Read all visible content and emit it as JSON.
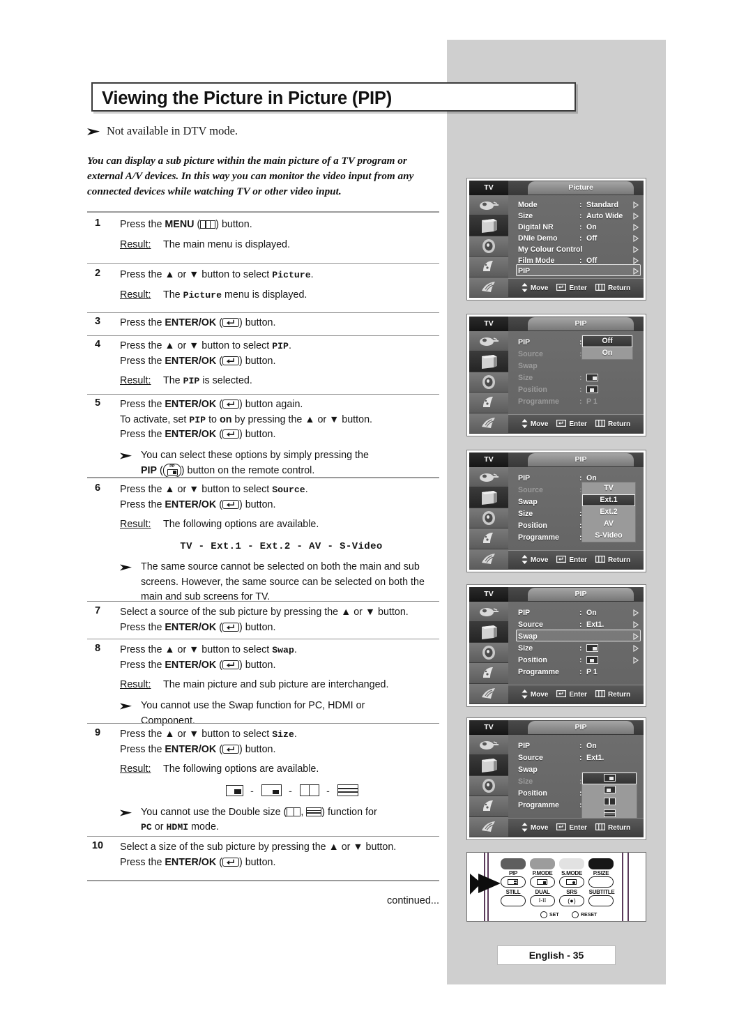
{
  "page": {
    "title": "Viewing the Picture in Picture (PIP)",
    "note": "Not available in DTV mode.",
    "intro": "You can display a sub picture within the main picture of a TV program or external A/V devices. In this way you can monitor the video input from any connected devices while watching TV or other video input.",
    "continued": "continued...",
    "footer_badge": "English - 35"
  },
  "labels": {
    "press_the": "Press the",
    "result": "Result:",
    "button_word": "button.",
    "or": "or"
  },
  "steps": [
    {
      "num": "1",
      "line1_a": "Press the ",
      "line1_b": "MENU",
      "line1_c": " (",
      "line1_d": ") button.",
      "result_label": "Result:",
      "result_text": "The main menu is displayed."
    },
    {
      "num": "2",
      "line1_a": "Press the ▲ or ▼ button to select ",
      "line1_b": "Picture",
      "line1_c": ".",
      "result_label": "Result:",
      "result_a": "The ",
      "result_b": "Picture",
      "result_c": " menu is displayed."
    },
    {
      "num": "3",
      "line1_a": "Press the ",
      "line1_b": "ENTER/OK",
      "line1_c": " (",
      "line1_d": ") button."
    },
    {
      "num": "4",
      "line1_a": "Press the ▲ or ▼ button to select ",
      "line1_b": "PIP",
      "line1_c": ".",
      "line2_a": "Press the ",
      "line2_b": "ENTER/OK",
      "line2_c": " (",
      "line2_d": ") button.",
      "result_label": "Result:",
      "result_a": "The ",
      "result_b": "PIP",
      "result_c": " is selected."
    },
    {
      "num": "5",
      "line1_a": "Press the ",
      "line1_b": "ENTER/OK",
      "line1_c": " (",
      "line1_d": ") button again.",
      "line2_a": "To activate, set ",
      "line2_b": "PIP",
      "line2_c": " to ",
      "line2_d": "on",
      "line2_e": " by pressing the ▲ or ▼ button.",
      "line3_a": "Press the ",
      "line3_b": "ENTER/OK",
      "line3_c": " (",
      "line3_d": ") button.",
      "bullet_a": "You can select these options by simply pressing the",
      "bullet_b": "PIP",
      "bullet_c": " (",
      "bullet_d": ") button on the remote control."
    },
    {
      "num": "6",
      "line1_a": "Press the ▲ or ▼ button to select ",
      "line1_b": "Source",
      "line1_c": ".",
      "line2_a": "Press the ",
      "line2_b": "ENTER/OK",
      "line2_c": " (",
      "line2_d": ") button.",
      "result_label": "Result:",
      "result_text": "The following options are available.",
      "options_line": "TV - Ext.1 - Ext.2 - AV - S-Video",
      "bullet_text": "The same source cannot be selected on both the main and sub screens. However, the same source can be selected on both the main and sub screens for TV."
    },
    {
      "num": "7",
      "line1_a": "Select a source of the sub picture by pressing the ▲ or ▼ button.",
      "line2_a": "Press the ",
      "line2_b": "ENTER/OK",
      "line2_c": " (",
      "line2_d": ") button."
    },
    {
      "num": "8",
      "line1_a": "Press the ▲ or ▼ button to select ",
      "line1_b": "Swap",
      "line1_c": ".",
      "line2_a": "Press the ",
      "line2_b": "ENTER/OK",
      "line2_c": " (",
      "line2_d": ") button.",
      "result_label": "Result:",
      "result_text": "The main picture and sub picture are interchanged.",
      "bullet_a": "You cannot use the Swap function for PC, HDMI or",
      "bullet_b": "Component."
    },
    {
      "num": "9",
      "line1_a": "Press the ▲ or ▼ button to select ",
      "line1_b": "Size",
      "line1_c": ".",
      "line2_a": "Press the ",
      "line2_b": "ENTER/OK",
      "line2_c": " (",
      "line2_d": ") button.",
      "result_label": "Result:",
      "result_text": "The following options are available.",
      "bullet_a": "You cannot use the Double size (",
      "bullet_b": ", ",
      "bullet_c": ") function for",
      "bullet_d": "PC",
      "bullet_e": " or ",
      "bullet_f": "HDMI",
      "bullet_g": " mode."
    },
    {
      "num": "10",
      "line1_a": "Select a size of the sub picture by pressing the ▲ or ▼ button.",
      "line2_a": "Press the ",
      "line2_b": "ENTER/OK",
      "line2_c": " (",
      "line2_d": ") button."
    }
  ],
  "osd_common": {
    "tv_label": "TV",
    "foot_move": "Move",
    "foot_enter": "Enter",
    "foot_return": "Return"
  },
  "osd_screens": [
    {
      "id": "picture-menu",
      "tab": "Picture",
      "rows": [
        {
          "label": "Mode",
          "colon": ":",
          "value": "Standard",
          "arrow": true
        },
        {
          "label": "Size",
          "colon": ":",
          "value": "Auto Wide",
          "arrow": true
        },
        {
          "label": "Digital NR",
          "colon": ":",
          "value": "On",
          "arrow": true
        },
        {
          "label": "DNIe Demo",
          "colon": ":",
          "value": "Off",
          "arrow": true
        },
        {
          "label": "My Colour Control",
          "colon": "",
          "value": "",
          "arrow": true
        },
        {
          "label": "Film Mode",
          "colon": ":",
          "value": "Off",
          "arrow": true
        },
        {
          "label": "PIP",
          "colon": "",
          "value": "",
          "arrow": true,
          "highlight": true
        }
      ]
    },
    {
      "id": "pip-onoff",
      "tab": "PIP",
      "rows": [
        {
          "label": "PIP",
          "colon": ":",
          "value": "",
          "arrow": false
        },
        {
          "label": "Source",
          "colon": ":",
          "value": "",
          "arrow": false,
          "dim": true
        },
        {
          "label": "Swap",
          "colon": "",
          "value": "",
          "arrow": false,
          "dim": true
        },
        {
          "label": "Size",
          "colon": ":",
          "value": "icon-br",
          "arrow": false,
          "dim": true
        },
        {
          "label": "Position",
          "colon": ":",
          "value": "icon-bl",
          "arrow": false,
          "dim": true
        },
        {
          "label": "Programme",
          "colon": ":",
          "value": "P  1",
          "arrow": false,
          "dim": true
        }
      ],
      "popup": {
        "items": [
          "Off",
          "On"
        ],
        "selected": "Off"
      }
    },
    {
      "id": "pip-source",
      "tab": "PIP",
      "rows": [
        {
          "label": "PIP",
          "colon": ":",
          "value": "On",
          "arrow": false
        },
        {
          "label": "Source",
          "colon": ":",
          "value": "",
          "arrow": false,
          "dim": true
        },
        {
          "label": "Swap",
          "colon": "",
          "value": "",
          "arrow": false
        },
        {
          "label": "Size",
          "colon": ":",
          "value": "",
          "arrow": false
        },
        {
          "label": "Position",
          "colon": ":",
          "value": "",
          "arrow": false
        },
        {
          "label": "Programme",
          "colon": ":",
          "value": "",
          "arrow": false
        }
      ],
      "popup": {
        "items": [
          "TV",
          "Ext.1",
          "Ext.2",
          "AV",
          "S-Video"
        ],
        "selected": "Ext.1"
      }
    },
    {
      "id": "pip-swap",
      "tab": "PIP",
      "rows": [
        {
          "label": "PIP",
          "colon": ":",
          "value": "On",
          "arrow": true
        },
        {
          "label": "Source",
          "colon": ":",
          "value": "Ext1.",
          "arrow": true
        },
        {
          "label": "Swap",
          "colon": "",
          "value": "",
          "arrow": true,
          "highlight": true
        },
        {
          "label": "Size",
          "colon": ":",
          "value": "icon-br",
          "arrow": true
        },
        {
          "label": "Position",
          "colon": ":",
          "value": "icon-bl",
          "arrow": true
        },
        {
          "label": "Programme",
          "colon": ":",
          "value": "P  1",
          "arrow": false
        }
      ]
    },
    {
      "id": "pip-size",
      "tab": "PIP",
      "rows": [
        {
          "label": "PIP",
          "colon": ":",
          "value": "On",
          "arrow": false
        },
        {
          "label": "Source",
          "colon": ":",
          "value": "Ext1.",
          "arrow": false
        },
        {
          "label": "Swap",
          "colon": "",
          "value": "",
          "arrow": false
        },
        {
          "label": "Size",
          "colon": ":",
          "value": "",
          "arrow": false,
          "dim": true
        },
        {
          "label": "Position",
          "colon": ":",
          "value": "",
          "arrow": false
        },
        {
          "label": "Programme",
          "colon": ":",
          "value": "",
          "arrow": false
        }
      ],
      "popup": {
        "items": [
          "icon-br",
          "icon-bl",
          "icon-v",
          "icon-h"
        ],
        "selected": "icon-br",
        "icons": true
      }
    }
  ],
  "remote": {
    "row_top_labels": [
      "PIP",
      "P.MODE",
      "S.MODE",
      "P.SIZE"
    ],
    "row_mid_labels": [
      "STILL",
      "DUAL",
      "SRS",
      "SUBTITLE"
    ],
    "dual_glyph": "I-II",
    "bottom_labels": [
      "SET",
      "RESET"
    ]
  }
}
